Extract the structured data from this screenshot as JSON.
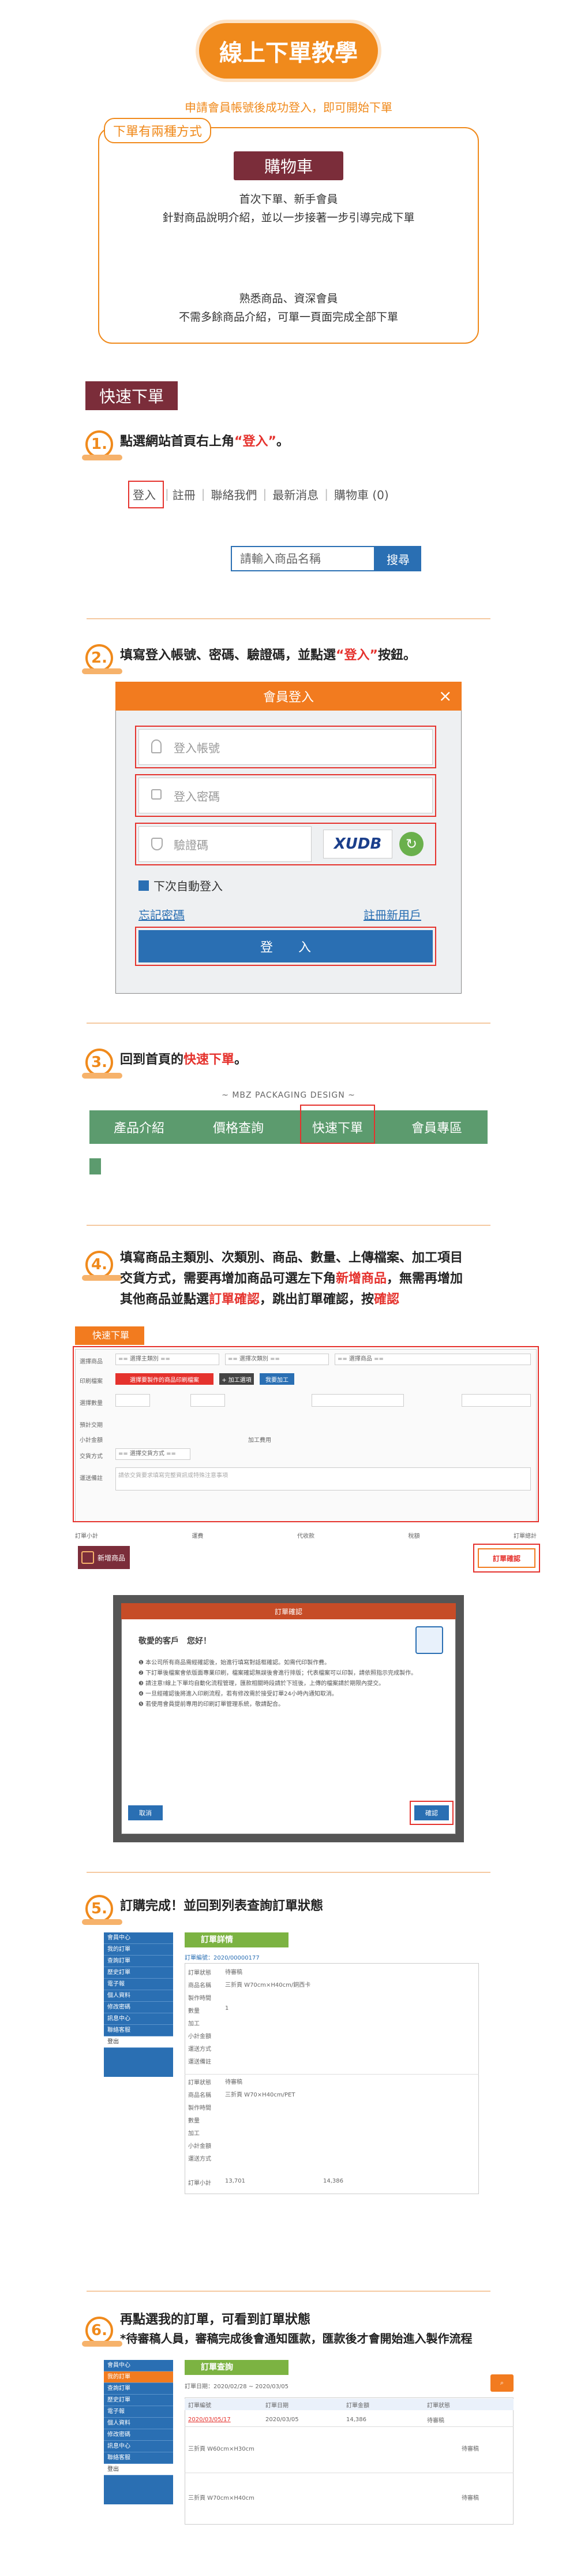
{
  "header": {
    "title": "線上下單教學",
    "intro": "申請會員帳號後成功登入，即可開始下單"
  },
  "methods": {
    "label": "下單有兩種方式",
    "cart": {
      "tag": "購物車",
      "line1": "首次下單、新手會員",
      "line2": "針對商品說明介紹，並以一步接著一步引導完成下單"
    },
    "quick": {
      "line1": "熟悉商品、資深會員",
      "line2": "不需多餘商品介紹，可單一頁面完成全部下單"
    }
  },
  "quick_order_tag": "快速下單",
  "step1": {
    "num": "1.",
    "text_prefix": "點選網站首頁右上角",
    "text_hl": "“登入”",
    "text_suffix": "。",
    "nav": [
      "登入",
      "註冊",
      "聯絡我們",
      "最新消息",
      "購物車 (0)"
    ],
    "search_placeholder": "請輸入商品名稱",
    "search_btn": "搜尋"
  },
  "step2": {
    "num": "2.",
    "text_prefix": "填寫登入帳號、密碼、驗證碼，並點選",
    "text_hl": "“登入”",
    "text_suffix": "按鈕。",
    "dialog_title": "會員登入",
    "close": "×",
    "account_placeholder": "登入帳號",
    "password_placeholder": "登入密碼",
    "captcha_placeholder": "驗證碼",
    "captcha": "XUDB",
    "remember": "下次自動登入",
    "forgot": "忘記密碼",
    "register": "註冊新用戶",
    "login_btn": "登　　入"
  },
  "step3": {
    "num": "3.",
    "text_prefix": "回到首頁的",
    "text_hl": "快速下單",
    "text_suffix": "。",
    "brand": "~ MBZ  PACKAGING  DESIGN ~",
    "menu": [
      "產品介紹",
      "價格查詢",
      "快速下單",
      "會員專區"
    ]
  },
  "step4": {
    "num": "4.",
    "line1": "填寫商品主類別、次類別、商品、數量、上傳檔案、加工項目",
    "line2_prefix": "交貨方式，需要再增加商品可選左下角",
    "line2_hl": "新增商品",
    "line2_suffix": "，無需再增加",
    "line3_prefix": "其他商品並點選",
    "line3_hl": "訂單確認",
    "line3_mid": "，跳出訂單確認，按",
    "line3_hl2": "確認",
    "form_tag": "快速下單",
    "labels": [
      "選擇商品",
      "印刷檔案",
      "選擇數量",
      "預計交期",
      "小計金額",
      "加工費用",
      "交貨方式",
      "運送備註"
    ],
    "select_main": "== 選擇主類別 ==",
    "select_sub": "== 選擇次類別 ==",
    "select_prod": "== 選擇商品 ==",
    "upload_btn": "選擇要製作的商品印刷檔案",
    "add_process": "+ 加工選項",
    "process_btn": "我要加工",
    "delivery": "== 選擇交貨方式 ==",
    "note_placeholder": "請依交貨要求填寫完整資訊或特殊注意事項",
    "totals": [
      "訂單小計",
      "運費",
      "代收款",
      "稅額",
      "訂單總計"
    ],
    "add_item": "新增商品",
    "confirm_order": "訂單確認",
    "modal_title": "訂單確認",
    "greeting": "敬愛的客戶　您好！",
    "notes": [
      "本公司所有商品需經確認後，始進行填寫對話框確認。如需代印製作費。",
      "下訂單後檔案會依版面專業印刷，檔案確認無誤後會進行排版；代表檔案可以印製，請依照指示完成製作。",
      "請注意!線上下單均自動化流程管理，匯款相關時段請於下班後，上傳的檔案請於期限內提交。",
      "一旦經確認後將進入印刷流程，若有修改需於接受訂單24小時內通知取消。",
      "若使用會員提前專用的印刷訂單管理系統，敬請配合。"
    ],
    "cancel": "取消",
    "ok": "確認"
  },
  "step5": {
    "num": "5.",
    "text": "訂購完成！並回到列表查詢訂單狀態",
    "section": "訂單詳情",
    "order_no": "訂單編號：2020/00000177",
    "sidebar": [
      "會員中心",
      "我的訂單",
      "查詢訂單",
      "歷史訂單",
      "電子報",
      "個人資料",
      "修改密碼",
      "訊息中心",
      "聯絡客服",
      "登出"
    ],
    "rows": [
      "訂單狀態",
      "商品名稱",
      "製作時間",
      "數量",
      "加工",
      "小計金額",
      "運送方式",
      "運送備註"
    ],
    "status1": "待審稿",
    "prod1": "三折頁 W70cm×H40cm/銅西卡",
    "status2": "待審稿",
    "prod2": "三折頁 W70×H40cm/PET",
    "qty": "1",
    "total_label": "訂單小計",
    "total": "13,701",
    "sum": "14,386"
  },
  "step6": {
    "num": "6.",
    "line1": "再點選我的訂單，可看到訂單狀態",
    "line2": "*待審稿人員，審稿完成後會通知匯款，匯款後才會開始進入製作流程",
    "section": "訂單查詢",
    "filter_label": "訂單日期：2020/02/28 ~ 2020/03/05",
    "headers": [
      "訂單編號",
      "訂單日期",
      "訂單金額",
      "訂單狀態"
    ],
    "order": "2020/03/05/17",
    "date": "2020/03/05",
    "amount": "14,386",
    "state": "待審稿",
    "items": [
      "三折頁 W60cm×H30cm",
      "三折頁 W70cm×H40cm"
    ],
    "item_states": [
      "待審稿",
      "待審稿"
    ]
  }
}
